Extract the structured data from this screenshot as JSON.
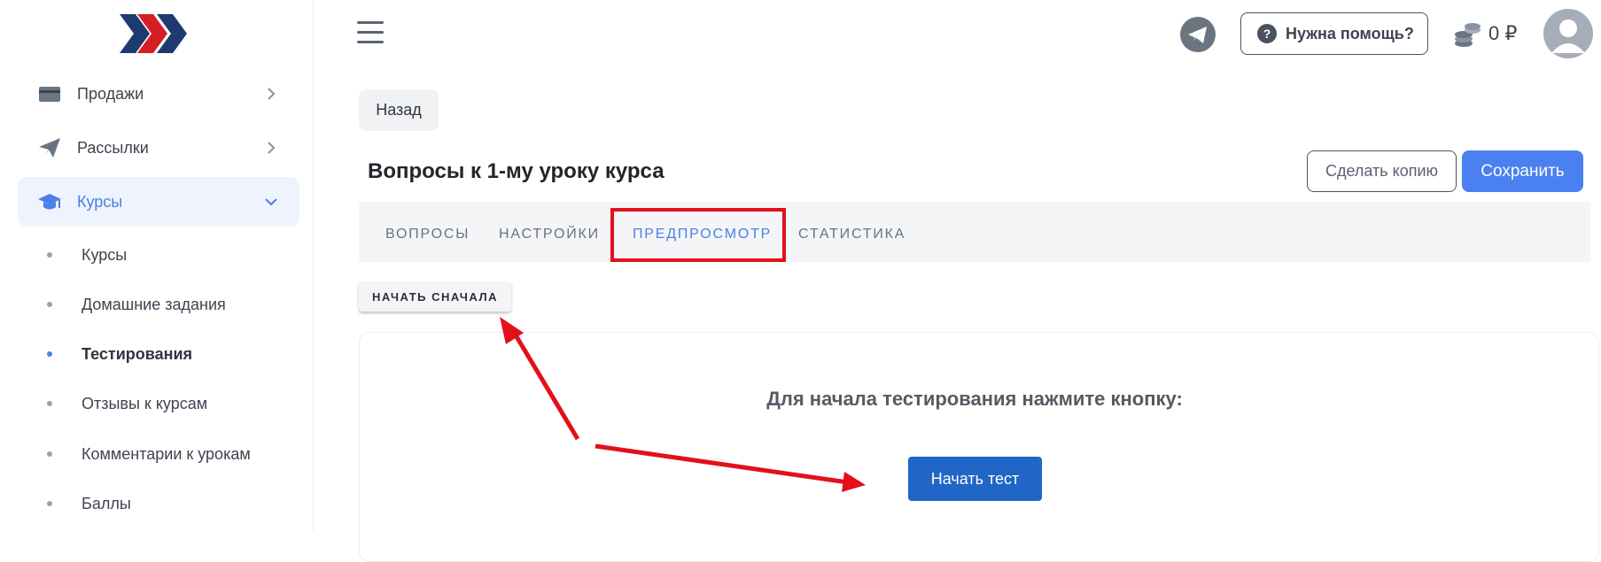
{
  "sidebar": {
    "items": [
      {
        "label": "Продажи",
        "icon": "credit-card-icon"
      },
      {
        "label": "Рассылки",
        "icon": "paper-plane-icon"
      },
      {
        "label": "Курсы",
        "icon": "graduation-cap-icon"
      }
    ],
    "sub_items": [
      {
        "label": "Курсы"
      },
      {
        "label": "Домашние задания"
      },
      {
        "label": "Тестирования"
      },
      {
        "label": "Отзывы к курсам"
      },
      {
        "label": "Комментарии к урокам"
      },
      {
        "label": "Баллы"
      }
    ]
  },
  "header": {
    "help_label": "Нужна помощь?",
    "help_icon_glyph": "?",
    "balance": "0 ₽"
  },
  "main": {
    "back_label": "Назад",
    "title": "Вопросы к 1-му уроку курса",
    "copy_label": "Сделать копию",
    "save_label": "Сохранить",
    "tabs": [
      {
        "label": "ВОПРОСЫ"
      },
      {
        "label": "НАСТРОЙКИ"
      },
      {
        "label": "ПРЕДПРОСМОТР"
      },
      {
        "label": "СТАТИСТИКА"
      }
    ],
    "active_tab": "ПРЕДПРОСМОТР",
    "restart_label": "НАЧАТЬ СНАЧАЛА",
    "prompt": "Для начала тестирования нажмите кнопку:",
    "start_label": "Начать тест"
  },
  "colors": {
    "accent": "#4a80e8",
    "save_button": "#4a80f0",
    "start_button": "#1f66c6",
    "annotation": "#e3101a",
    "logo_navy": "#1e3a6e",
    "logo_red": "#d51f26"
  }
}
